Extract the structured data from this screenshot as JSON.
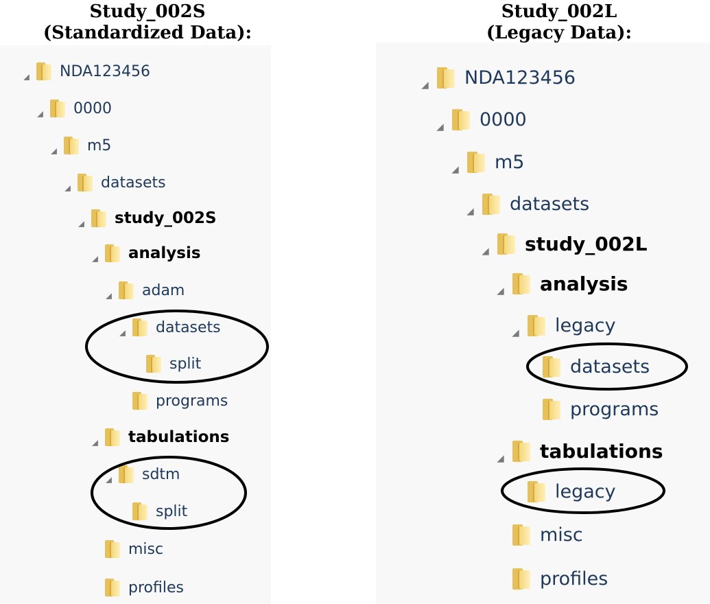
{
  "left_title": {
    "line1": "Study_002S",
    "line2": "(Standardized Data):"
  },
  "right_title": {
    "line1": "Study_002L",
    "line2": "(Legacy Data):"
  },
  "colors": {
    "folder": "#e6c05a",
    "folder_light": "#fff0bb",
    "text": "#1e395b",
    "triangle": "#7a7a7a"
  },
  "left_tree": [
    {
      "label": "NDA123456",
      "expander": true,
      "bold": false
    },
    {
      "label": "0000",
      "expander": true,
      "bold": false
    },
    {
      "label": "m5",
      "expander": true,
      "bold": false
    },
    {
      "label": "datasets",
      "expander": true,
      "bold": false
    },
    {
      "label": "study_002S",
      "expander": true,
      "bold": true
    },
    {
      "label": "analysis",
      "expander": true,
      "bold": true
    },
    {
      "label": "adam",
      "expander": true,
      "bold": false
    },
    {
      "label": "datasets",
      "expander": true,
      "bold": false
    },
    {
      "label": "split",
      "expander": false,
      "bold": false
    },
    {
      "label": "programs",
      "expander": false,
      "bold": false
    },
    {
      "label": "tabulations",
      "expander": true,
      "bold": true
    },
    {
      "label": "sdtm",
      "expander": true,
      "bold": false
    },
    {
      "label": "split",
      "expander": false,
      "bold": false
    },
    {
      "label": "misc",
      "expander": false,
      "bold": false
    },
    {
      "label": "profiles",
      "expander": false,
      "bold": false
    }
  ],
  "right_tree": [
    {
      "label": "NDA123456",
      "expander": true,
      "bold": false
    },
    {
      "label": "0000",
      "expander": true,
      "bold": false
    },
    {
      "label": "m5",
      "expander": true,
      "bold": false
    },
    {
      "label": "datasets",
      "expander": true,
      "bold": false
    },
    {
      "label": "study_002L",
      "expander": true,
      "bold": true
    },
    {
      "label": "analysis",
      "expander": true,
      "bold": true
    },
    {
      "label": "legacy",
      "expander": true,
      "bold": false
    },
    {
      "label": "datasets",
      "expander": false,
      "bold": false
    },
    {
      "label": "programs",
      "expander": false,
      "bold": false
    },
    {
      "label": "tabulations",
      "expander": true,
      "bold": true
    },
    {
      "label": "legacy",
      "expander": false,
      "bold": false
    },
    {
      "label": "misc",
      "expander": false,
      "bold": false
    },
    {
      "label": "profiles",
      "expander": false,
      "bold": false
    }
  ]
}
